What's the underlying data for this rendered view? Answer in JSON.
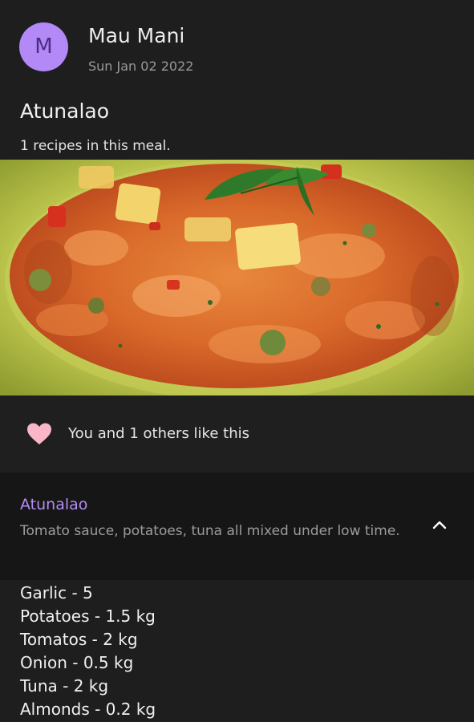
{
  "post": {
    "avatar_letter": "M",
    "author": "Mau Mani",
    "date": "Sun Jan 02 2022",
    "meal_title": "Atunalao",
    "meal_subtitle": "1 recipes in this meal.",
    "image_icon": "meal-photo"
  },
  "likes": {
    "icon": "heart-icon",
    "text": "You and 1 others like this"
  },
  "recipe": {
    "name": "Atunalao",
    "description": "Tomato sauce, potatoes, tuna all mixed under low time.",
    "expand_icon": "chevron-up-icon",
    "ingredients": [
      "Garlic - 5",
      "Potatoes - 1.5 kg",
      "Tomatos - 2 kg",
      "Onion - 0.5 kg",
      "Tuna - 2 kg",
      "Almonds - 0.2 kg"
    ]
  },
  "colors": {
    "background": "#1e1e1f",
    "accent": "#b58cf4",
    "avatar": "#b388f7",
    "heart": "#f8b6c6"
  }
}
